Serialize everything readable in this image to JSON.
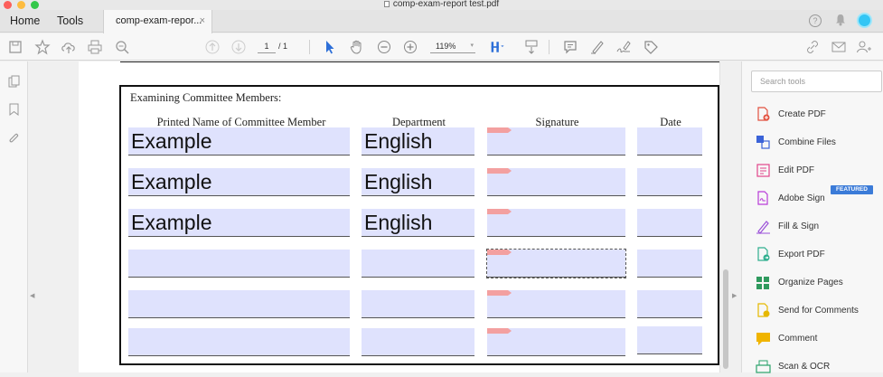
{
  "window": {
    "title": "comp-exam-report test.pdf"
  },
  "tabs": {
    "home": "Home",
    "tools": "Tools",
    "document": "comp-exam-repor...",
    "close": "×"
  },
  "header": {
    "help": "?"
  },
  "toolbar": {
    "page_current": "1",
    "page_total": "/ 1",
    "zoom": "119%",
    "zoom_arrow": "▾"
  },
  "form": {
    "section_title": "Examining Committee Members:",
    "columns": [
      "Printed Name of Committee Member",
      "Department",
      "Signature",
      "Date"
    ],
    "rows": [
      {
        "name": "Example",
        "department": "English",
        "date": ""
      },
      {
        "name": "Example",
        "department": "English",
        "date": ""
      },
      {
        "name": "Example",
        "department": "English",
        "date": ""
      },
      {
        "name": "",
        "department": "",
        "date": ""
      },
      {
        "name": "",
        "department": "",
        "date": ""
      },
      {
        "name": "",
        "department": "",
        "date": ""
      }
    ]
  },
  "tools_pane": {
    "search_placeholder": "Search tools",
    "featured_badge": "FEATURED",
    "items": [
      {
        "label": "Create PDF",
        "icon": "create-pdf-icon",
        "color": "#e2513f"
      },
      {
        "label": "Combine Files",
        "icon": "combine-files-icon",
        "color": "#3b63d8"
      },
      {
        "label": "Edit PDF",
        "icon": "edit-pdf-icon",
        "color": "#e2468b"
      },
      {
        "label": "Adobe Sign",
        "icon": "adobe-sign-icon",
        "color": "#b83cd8"
      },
      {
        "label": "Fill & Sign",
        "icon": "fill-sign-icon",
        "color": "#9a4fd8"
      },
      {
        "label": "Export PDF",
        "icon": "export-pdf-icon",
        "color": "#2fae8e"
      },
      {
        "label": "Organize Pages",
        "icon": "organize-pages-icon",
        "color": "#2f9a5e"
      },
      {
        "label": "Send for Comments",
        "icon": "send-for-comments-icon",
        "color": "#e6b800"
      },
      {
        "label": "Comment",
        "icon": "comment-icon",
        "color": "#f0b400"
      },
      {
        "label": "Scan & OCR",
        "icon": "scan-ocr-icon",
        "color": "#2aa36b"
      }
    ]
  }
}
